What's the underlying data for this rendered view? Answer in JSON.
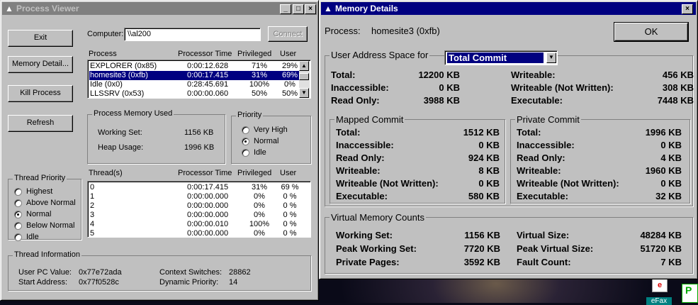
{
  "pv": {
    "title": "Process Viewer",
    "btn_exit": "Exit",
    "btn_mem": "Memory Detail...",
    "btn_kill": "Kill Process",
    "btn_refresh": "Refresh",
    "computer_label": "Computer:",
    "computer_value": "\\\\al200",
    "btn_connect": "Connect",
    "proc_headers": [
      "Process",
      "Processor Time",
      "Privileged",
      "User"
    ],
    "processes": [
      [
        "EXPLORER (0x85)",
        "0:00:12.628",
        "71%",
        "29%"
      ],
      [
        "homesite3 (0xfb)",
        "0:00:17.415",
        "31%",
        "69%"
      ],
      [
        "Idle (0x0)",
        "0:28:45.691",
        "100%",
        "0%"
      ],
      [
        "LLSSRV (0x53)",
        "0:00:00.060",
        "50%",
        "50%"
      ]
    ],
    "mem_used_label": "Process Memory Used",
    "ws_label": "Working Set:",
    "ws_value": "1156 KB",
    "heap_label": "Heap Usage:",
    "heap_value": "1996 KB",
    "priority_label": "Priority",
    "priorities": [
      "Very High",
      "Normal",
      "Idle"
    ],
    "tp_label": "Thread Priority",
    "thread_priorities": [
      "Highest",
      "Above Normal",
      "Normal",
      "Below Normal",
      "Idle"
    ],
    "thread_headers": [
      "Thread(s)",
      "Processor Time",
      "Privileged",
      "User"
    ],
    "threads": [
      [
        "0",
        "0:00:17.415",
        "31%",
        "69 %"
      ],
      [
        "1",
        "0:00:00.000",
        "0%",
        "0 %"
      ],
      [
        "2",
        "0:00:00.000",
        "0%",
        "0 %"
      ],
      [
        "3",
        "0:00:00.000",
        "0%",
        "0 %"
      ],
      [
        "4",
        "0:00:00.010",
        "100%",
        "0 %"
      ],
      [
        "5",
        "0:00:00.000",
        "0%",
        "0 %"
      ]
    ],
    "ti_label": "Thread Information",
    "pc_label": "User PC Value:",
    "pc_value": "0x77e72ada",
    "start_label": "Start Address:",
    "start_value": "0x77f0528c",
    "cs_label": "Context Switches:",
    "cs_value": "28862",
    "dp_label": "Dynamic Priority:",
    "dp_value": "14"
  },
  "md": {
    "title": "Memory Details",
    "process_label": "Process:",
    "process_value": "homesite3 (0xfb)",
    "ok": "OK",
    "uas_label": "User Address Space for",
    "uas_select": "Total Commit",
    "uas_left": [
      [
        "Total:",
        "12200 KB"
      ],
      [
        "Inaccessible:",
        "0 KB"
      ],
      [
        "Read Only:",
        "3988 KB"
      ]
    ],
    "uas_right": [
      [
        "Writeable:",
        "456 KB"
      ],
      [
        "Writeable (Not Written):",
        "308 KB"
      ],
      [
        "Executable:",
        "7448 KB"
      ]
    ],
    "mapped_label": "Mapped Commit",
    "mapped": [
      [
        "Total:",
        "1512 KB"
      ],
      [
        "Inaccessible:",
        "0 KB"
      ],
      [
        "Read Only:",
        "924 KB"
      ],
      [
        "Writeable:",
        "8 KB"
      ],
      [
        "Writeable (Not Written):",
        "0 KB"
      ],
      [
        "Executable:",
        "580 KB"
      ]
    ],
    "private_label": "Private Commit",
    "private": [
      [
        "Total:",
        "1996 KB"
      ],
      [
        "Inaccessible:",
        "0 KB"
      ],
      [
        "Read Only:",
        "4 KB"
      ],
      [
        "Writeable:",
        "1960 KB"
      ],
      [
        "Writeable (Not Written):",
        "0 KB"
      ],
      [
        "Executable:",
        "32 KB"
      ]
    ],
    "vmc_label": "Virtual Memory Counts",
    "vmc_left": [
      [
        "Working Set:",
        "1156 KB"
      ],
      [
        "Peak Working Set:",
        "7720 KB"
      ],
      [
        "Private Pages:",
        "3592 KB"
      ]
    ],
    "vmc_right": [
      [
        "Virtual Size:",
        "48284 KB"
      ],
      [
        "Peak Virtual Size:",
        "51720 KB"
      ],
      [
        "Fault Count:",
        "7 KB"
      ]
    ]
  },
  "desktop": {
    "efax": "eFax"
  }
}
